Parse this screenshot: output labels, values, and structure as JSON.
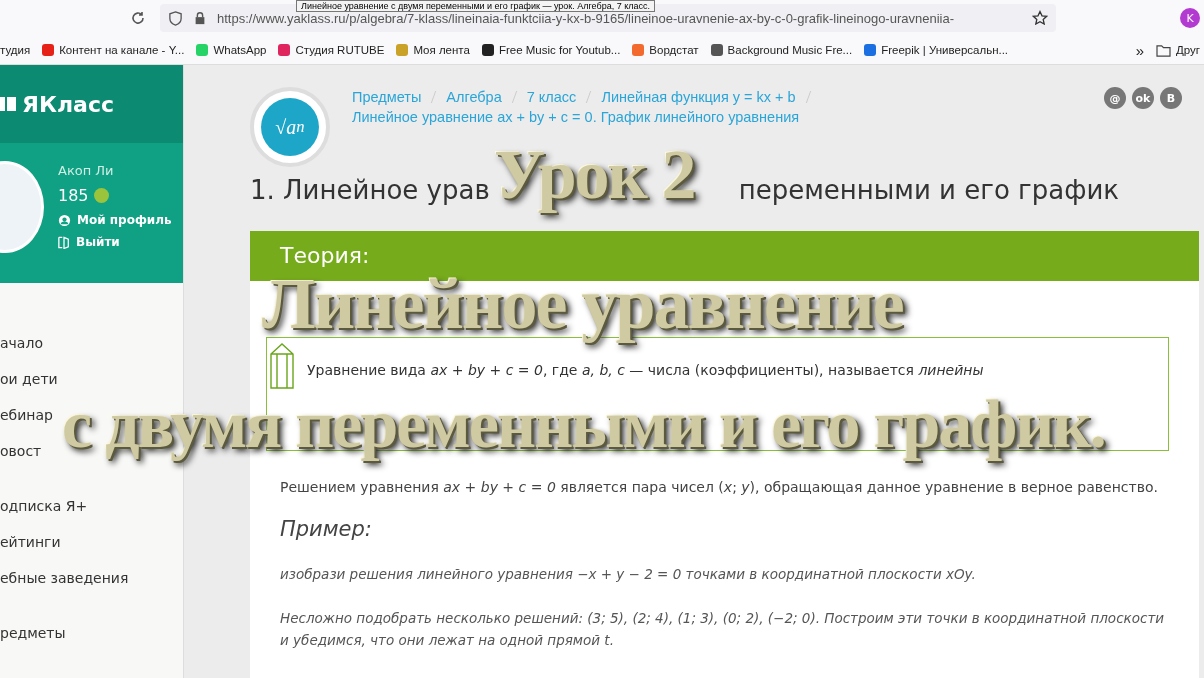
{
  "browser": {
    "tooltip": "Линейное уравнение с двумя переменными и его график — урок. Алгебра, 7 класс.",
    "url": "https://www.yaklass.ru/p/algebra/7-klass/lineinaia-funktciia-y-kx-b-9165/lineinoe-uravnenie-ax-by-c-0-grafik-lineinogo-uravneniia-",
    "profile_letter": "K",
    "bookmarks": [
      {
        "label": "тудия",
        "kind": "plain"
      },
      {
        "label": "Контент на канале - Y...",
        "kind": "youtube"
      },
      {
        "label": "WhatsApp",
        "kind": "whatsapp"
      },
      {
        "label": "Студия RUTUBE",
        "kind": "rutube"
      },
      {
        "label": "Моя лента",
        "kind": "shield"
      },
      {
        "label": "Free Music for Youtub...",
        "kind": "b"
      },
      {
        "label": "Вордстат",
        "kind": "orange"
      },
      {
        "label": "Background Music Fre...",
        "kind": "bars"
      },
      {
        "label": "Freepik | Универсальн...",
        "kind": "freepik"
      }
    ],
    "more": "»",
    "folder": "Друг"
  },
  "sidebar": {
    "logo": "ЯКласс",
    "user_name": "Акоп Ли",
    "points": "185",
    "profile_link": "Мой профиль",
    "logout": "Выйти",
    "items": [
      {
        "label": "ачало"
      },
      {
        "label": "ои дети"
      },
      {
        "label": "ебинар"
      },
      {
        "label": "овост"
      },
      {
        "label": "одписка Я+"
      },
      {
        "label": "ейтинги"
      },
      {
        "label": "ебные заведения"
      },
      {
        "label": "редметы"
      }
    ]
  },
  "main": {
    "subject_icon": {
      "root": "√a",
      "power": "n"
    },
    "breadcrumbs": [
      "Предметы",
      "Алгебра",
      "7 класс",
      "Линейная функция y = kx + b",
      "Линейное уравнение ax + by + c = 0. График линейного уравнения"
    ],
    "share": [
      "@",
      "ok",
      "В"
    ],
    "heading_parts": [
      "1. Линейное урав",
      "переменными и его график"
    ],
    "theory_title": "Теория:",
    "definition": "Уравнение вида *ax + by + c = 0*, где *a, b, c* — числа (коэффициенты), называется *линейны*",
    "solution": "Решением уравнения *ax + by + c = 0* является пара чисел (*x*; *y*), обращающая данное уравнение в верное равенство.",
    "example_title": "Пример:",
    "example_task": "изобрази решения линейного уравнения *−x + y − 2 = 0* точками в координатной плоскости *xOy*.",
    "example_text": "Несложно подобрать несколько решений: *(3; 5), (2; 4), (1; 3), (0; 2), (−2; 0)*. Построим эти точки в координатной плоскости и убедимся, что они лежат на одной прямой *t*."
  },
  "overlay": [
    "Урок 2",
    "Линейное уравнение",
    "с двумя переменными и его график."
  ]
}
